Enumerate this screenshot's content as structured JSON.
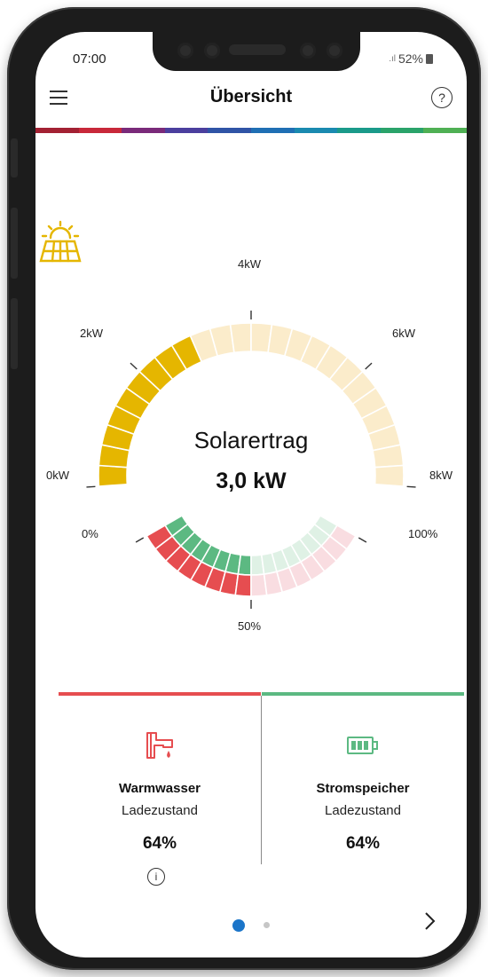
{
  "status_bar": {
    "time": "07:00",
    "signal": ".ıl",
    "battery_percent": "52%"
  },
  "app_bar": {
    "title": "Übersicht",
    "help_glyph": "?"
  },
  "icons": {
    "menu": "menu-icon",
    "help": "help-icon",
    "sun_panel": "solar-panel-icon",
    "faucet": "hot-water-faucet-icon",
    "battery": "battery-icon",
    "info": "info-icon",
    "next": "chevron-right-icon"
  },
  "colors": {
    "solar_fill": "#e5b600",
    "solar_empty": "#fbeccb",
    "green": "#5cb982",
    "green_light": "#dff1e5",
    "red": "#e64d50",
    "red_light": "#f9dde1"
  },
  "solar_gauge": {
    "label": "Solarertrag",
    "value_text": "3,0 kW",
    "value_kw": 3.0,
    "max_kw": 8,
    "tick_labels": [
      "0kW",
      "2kW",
      "4kW",
      "6kW",
      "8kW"
    ]
  },
  "balance_gauge": {
    "tick_labels": [
      "0%",
      "50%",
      "100%"
    ],
    "green_fraction": 0.5,
    "red_fraction": 0.5
  },
  "cards": [
    {
      "name": "Warmwasser",
      "subtitle": "Ladezustand",
      "value": "64%",
      "accent": "#e64d50"
    },
    {
      "name": "Stromspeicher",
      "subtitle": "Ladezustand",
      "value": "64%",
      "accent": "#5cb982"
    }
  ],
  "info_glyph": "i",
  "pagination": {
    "current_page": 1,
    "total_pages": 2
  }
}
